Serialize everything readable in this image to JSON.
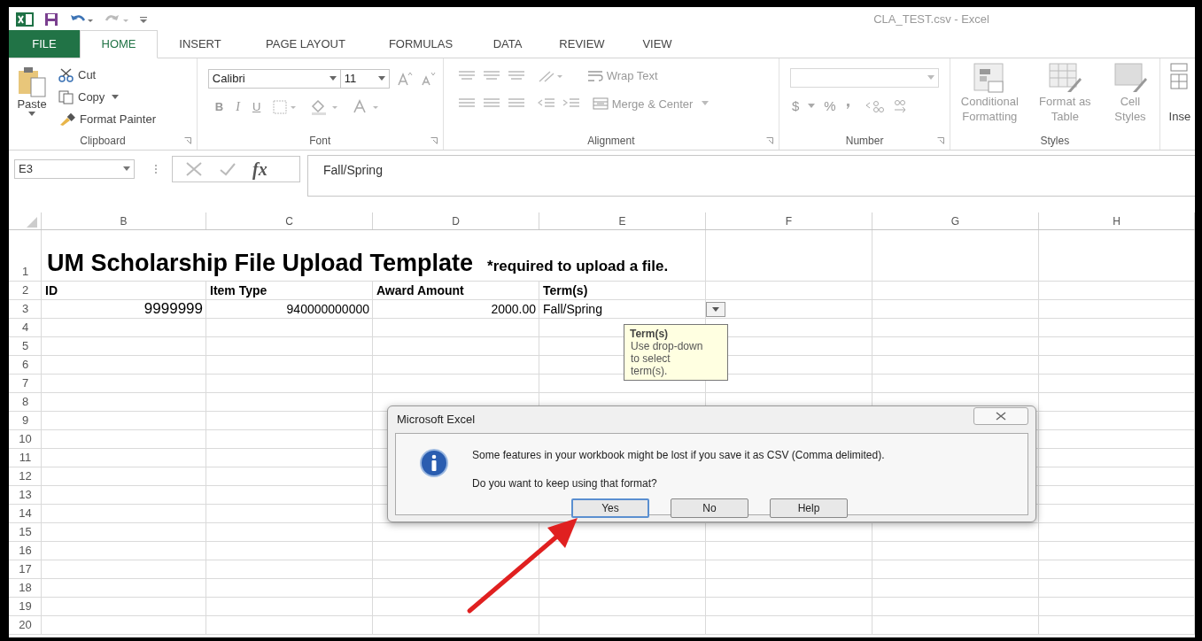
{
  "window": {
    "title": "CLA_TEST.csv - Excel"
  },
  "ribbon_tabs": [
    {
      "label": "FILE",
      "kind": "file",
      "selected": false
    },
    {
      "label": "HOME",
      "kind": "tab",
      "selected": true
    },
    {
      "label": "INSERT",
      "kind": "tab",
      "selected": false
    },
    {
      "label": "PAGE LAYOUT",
      "kind": "tab",
      "selected": false
    },
    {
      "label": "FORMULAS",
      "kind": "tab",
      "selected": false
    },
    {
      "label": "DATA",
      "kind": "tab",
      "selected": false
    },
    {
      "label": "REVIEW",
      "kind": "tab",
      "selected": false
    },
    {
      "label": "VIEW",
      "kind": "tab",
      "selected": false
    }
  ],
  "clipboard": {
    "paste": "Paste",
    "cut": "Cut",
    "copy": "Copy",
    "format_painter": "Format Painter",
    "group_label": "Clipboard"
  },
  "font": {
    "family": "Calibri",
    "size": "11",
    "bold": "B",
    "italic": "I",
    "underline": "U",
    "group_label": "Font"
  },
  "alignment": {
    "wrap_text": "Wrap Text",
    "merge_center": "Merge & Center",
    "group_label": "Alignment"
  },
  "number": {
    "currency": "$",
    "percent": "%",
    "group_label": "Number"
  },
  "styles": {
    "items": [
      {
        "lines": [
          "Conditional",
          "Formatting"
        ]
      },
      {
        "lines": [
          "Format as",
          "Table"
        ]
      },
      {
        "lines": [
          "Cell",
          "Styles"
        ]
      }
    ],
    "group_label": "Styles"
  },
  "cells": {
    "insert": "Inse"
  },
  "formula_bar": {
    "name_box": "E3",
    "fx": "fx",
    "content": "Fall/Spring"
  },
  "columns": [
    "B",
    "C",
    "D",
    "E",
    "F",
    "G",
    "H"
  ],
  "rows": [
    {
      "number": "1",
      "kind": "title",
      "title": "UM Scholarship File Upload Template",
      "note": "*required to upload a file."
    },
    {
      "number": "2",
      "kind": "header",
      "cells": [
        "ID",
        "Item Type",
        "Award Amount",
        "Term(s)"
      ]
    },
    {
      "number": "3",
      "kind": "data",
      "cells": [
        "9999999",
        "940000000000",
        "2000.00",
        "Fall/Spring"
      ]
    },
    {
      "number": "4",
      "kind": "empty"
    },
    {
      "number": "5",
      "kind": "empty"
    },
    {
      "number": "6",
      "kind": "empty"
    },
    {
      "number": "7",
      "kind": "empty"
    },
    {
      "number": "8",
      "kind": "empty"
    },
    {
      "number": "9",
      "kind": "empty"
    },
    {
      "number": "10",
      "kind": "empty"
    },
    {
      "number": "11",
      "kind": "empty"
    },
    {
      "number": "12",
      "kind": "empty"
    },
    {
      "number": "13",
      "kind": "empty"
    },
    {
      "number": "14",
      "kind": "empty"
    },
    {
      "number": "15",
      "kind": "empty"
    },
    {
      "number": "16",
      "kind": "empty"
    },
    {
      "number": "17",
      "kind": "empty"
    },
    {
      "number": "18",
      "kind": "empty"
    },
    {
      "number": "19",
      "kind": "empty"
    },
    {
      "number": "20",
      "kind": "empty"
    }
  ],
  "input_hint": {
    "title": "Term(s)",
    "text": "Use drop-down to select term(s)."
  },
  "dialog": {
    "title": "Microsoft Excel",
    "message": "Some features in your workbook might be lost if you save it as CSV (Comma delimited).",
    "question": "Do you want to keep using that format?",
    "buttons": [
      {
        "label": "Yes",
        "selected": true
      },
      {
        "label": "No",
        "selected": false
      },
      {
        "label": "Help",
        "selected": false
      }
    ]
  }
}
